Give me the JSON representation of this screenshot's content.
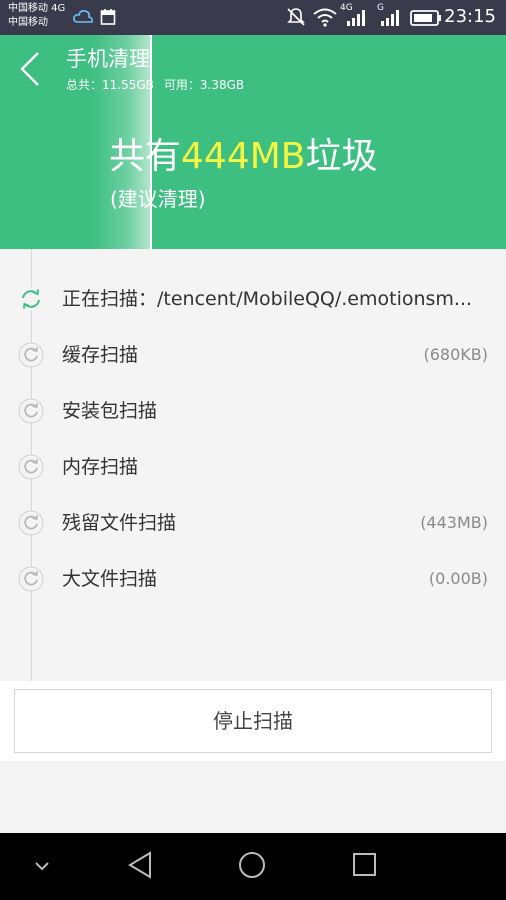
{
  "status_bar": {
    "carrier_1": "中国移动 4G",
    "carrier_2": "中国移动",
    "network_1": "4G",
    "network_2": "G",
    "time": "23:15",
    "icons": [
      "weather-icon",
      "calendar-icon",
      "mute-icon",
      "wifi-icon",
      "signal-icon",
      "battery-icon"
    ]
  },
  "header": {
    "title": "手机清理",
    "storage_total": "总共：11.55GB",
    "storage_free": "可用：3.38GB",
    "junk_prefix": "共有",
    "junk_amount": "444MB",
    "junk_suffix": "垃圾",
    "suggestion": "(建议清理)",
    "bg_color": "#3dbf82",
    "highlight_color": "#f5f542"
  },
  "scan_items": [
    {
      "label": "正在扫描：",
      "path": "/tencent/MobileQQ/.emotionsm...",
      "size": "",
      "status": "scanning"
    },
    {
      "label": "缓存扫描",
      "size": "(680KB)",
      "status": "pending"
    },
    {
      "label": "安装包扫描",
      "size": "",
      "status": "pending"
    },
    {
      "label": "内存扫描",
      "size": "",
      "status": "pending"
    },
    {
      "label": "残留文件扫描",
      "size": "(443MB)",
      "status": "pending"
    },
    {
      "label": "大文件扫描",
      "size": "(0.00B)",
      "status": "pending"
    }
  ],
  "stop_button": {
    "label": "停止扫描"
  },
  "nav_bar": {
    "icons": [
      "collapse-icon",
      "back-icon",
      "home-icon",
      "recents-icon"
    ]
  }
}
